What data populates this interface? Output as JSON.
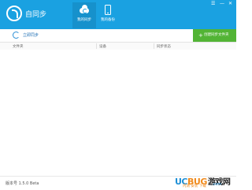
{
  "app": {
    "title": "自同步"
  },
  "tabs": [
    {
      "label": "我的同步",
      "active": true
    },
    {
      "label": "我的备份",
      "active": false
    }
  ],
  "window_controls": {
    "menu": "☰",
    "minimize": "—",
    "close": "✕"
  },
  "toolbar": {
    "sync_now": "立即同步",
    "create_plus": "+",
    "create_label": "创建同步文件夹"
  },
  "table": {
    "columns": [
      "文件夹",
      "设备",
      "同步状态"
    ],
    "rows": []
  },
  "footer": {
    "version": "版本号 1.5.0 Beta"
  },
  "watermark": {
    "brand_uc": "UC",
    "brand_bug": "BUG",
    "brand_cn": "游戏网",
    "domain": ".com",
    "tagline": "内测 安装 下载"
  },
  "colors": {
    "titlebar": "#1aa1e1",
    "active_tab": "#1691cc",
    "create_button": "#52b435",
    "link": "#1f6fb5"
  }
}
